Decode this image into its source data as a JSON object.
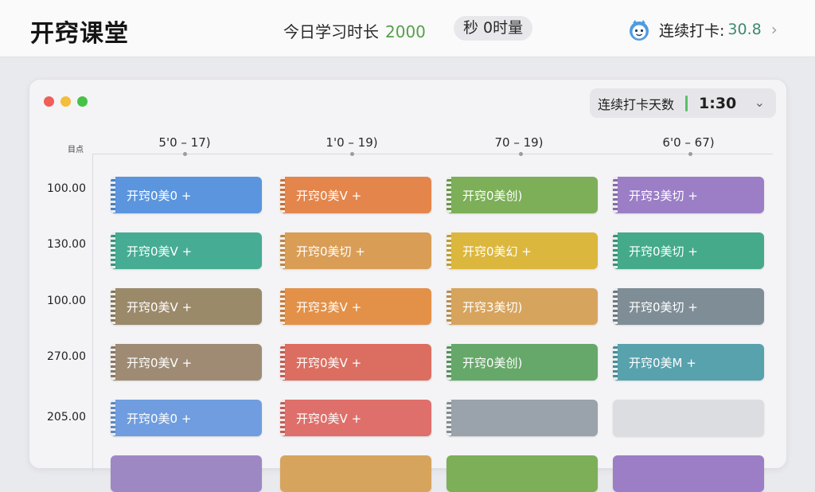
{
  "header": {
    "brand": "开窍课堂",
    "study_label": "今日学习时长",
    "study_value": "2000",
    "pill_text": "秒 0时量",
    "streak_label": "连续打卡:",
    "streak_value": "30.8",
    "chevron": "›"
  },
  "window": {
    "control": {
      "label": "连续打卡天数",
      "time": "1:30",
      "chevron": "⌄"
    },
    "axis_label": "目点",
    "columns": [
      "5'0 – 17)",
      "1'0 – 19)",
      "70 – 19)",
      "6'0 – 67)"
    ],
    "rows": [
      "100.00",
      "130.00",
      "100.00",
      "270.00",
      "205.00"
    ],
    "cards": [
      [
        {
          "text": "开窍0美0 +",
          "color": "#5b95de"
        },
        {
          "text": "开窍0美V +",
          "color": "#e4854b"
        },
        {
          "text": "开窍0美创)",
          "color": "#7caf58"
        },
        {
          "text": "开窍3美切 +",
          "color": "#9b7ec6"
        }
      ],
      [
        {
          "text": "开窍0美V +",
          "color": "#46ac94"
        },
        {
          "text": "开窍0美切 +",
          "color": "#d99d56"
        },
        {
          "text": "开窍0美幻 +",
          "color": "#dcb73e"
        },
        {
          "text": "开窍0美切 +",
          "color": "#44aa8a"
        }
      ],
      [
        {
          "text": "开窍0美V +",
          "color": "#9b8a6a"
        },
        {
          "text": "开窍3美V +",
          "color": "#e39148"
        },
        {
          "text": "开窍3美切)",
          "color": "#d7a45e"
        },
        {
          "text": "开窍0美切 +",
          "color": "#7f8d96"
        }
      ],
      [
        {
          "text": "开窍0美V +",
          "color": "#9f8b74"
        },
        {
          "text": "开窍0美V +",
          "color": "#dc6e61"
        },
        {
          "text": "开窍0美创)",
          "color": "#66a86a"
        },
        {
          "text": "开窍0美M +",
          "color": "#58a2ae"
        }
      ],
      [
        {
          "text": "开窍0美0 +",
          "color": "#6f9ddf"
        },
        {
          "text": "开窍0美V +",
          "color": "#df6f6a"
        },
        {
          "text": "",
          "color": "#9aa2ab"
        },
        {
          "text": "",
          "color": "#dcdde1"
        }
      ]
    ]
  }
}
